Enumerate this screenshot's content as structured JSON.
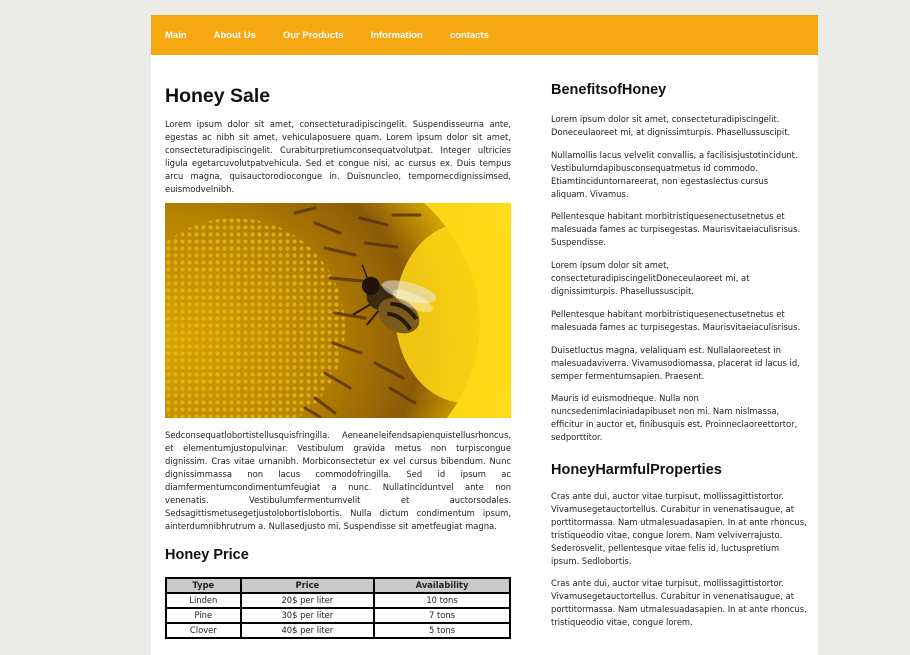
{
  "nav": {
    "items": [
      "Main",
      "About Us",
      "Our Products",
      "Information",
      "contacts"
    ]
  },
  "left": {
    "title": "Honey Sale",
    "intro": "Lorem ipsum dolor sit amet, consecteturadipiscingelit. Suspendisseurna ante, egestas ac nibh sit amet, vehiculaposuere quam. Lorem ipsum dolor sit amet, consecteturadipiscingelit. Curabiturpretiumconsequatvolutpat. Integer ultricies ligula egetarcuvolutpatvehicula. Sed et congue nisi, ac cursus ex. Duis tempus arcu magna, quisauctorodiocongue in. Duisnuncleo, tempornecdignissimsed, euismodvelnibh.",
    "body": "Sedconsequatlobortistellusquisfringilla. Aeneaneleifendsapienquistellusrhoncus, et elementumjustopulvinar. Vestibulum gravida metus non turpiscongue dignissim. Cras vitae urnanibh. Morbiconsectetur ex vel cursus bibendum. Nunc dignissimmassa non lacus commodofringilla. Sed id ipsum ac diamfermentumcondimentumfeugiat a nunc. Nullatinciduntvel ante non venenatis. Vestibulumfermentumvelit et auctorsodales. Sedsagittismetusegetjustolobortislobortis. Nulla dictum condimentum ipsum, ainterdumnibhrutrum a. Nullasedjusto mi. Suspendisse sit ametfeugiat magna.",
    "price_title": "Honey Price",
    "table": {
      "headers": [
        "Type",
        "Price",
        "Availability"
      ],
      "rows": [
        [
          "Linden",
          "20$ per liter",
          "10 tons"
        ],
        [
          "Pine",
          "30$ per liter",
          "7 tons"
        ],
        [
          "Clover",
          "40$ per liter",
          "5 tons"
        ]
      ]
    }
  },
  "right": {
    "benefits_title": "BenefitsofHoney",
    "benefits": [
      "Lorem ipsum dolor sit amet, consecteturadipiscingelit. Doneceulaoreet mi, at dignissimturpis. Phasellussuscipit.",
      "Nullamollis lacus velvelit convallis, a facilisisjustotincidunt. Vestibulumdapibusconsequatmetus id commodo. Etiamtinciduntornareerat, non egestaslectus cursus aliquam. Vivamus.",
      "Pellentesque habitant morbitristiquesenectusetnetus et malesuada fames ac turpisegestas. Maurisvitaeiaculisrisus. Suspendisse.",
      "Lorem ipsum dolor sit amet, consecteturadipiscingelitDoneceulaoreet mi, at dignissimturpis. Phasellussuscipit.",
      "Pellentesque habitant morbitristiquesenectusetnetus et malesuada fames ac turpisegestas. Maurisvitaeiaculisrisus.",
      "Duisetluctus magna, velaliquam est. Nullalaoreetest in malesuadaviverra. Vivamusodiomassa, placerat id lacus id, semper fermentumsapien. Praesent.",
      "Mauris id euismodneque. Nulla non nuncsedenimlaciniadapibuset non mi. Nam nislmassa, efficitur in auctor et, finibusquis est. Proinneclaoreettortor, sedporttitor."
    ],
    "harmful_title": "HoneyHarmfulProperties",
    "harmful": [
      "Cras ante dui, auctor vitae turpisut, mollissagittistortor. Vivamusegetauctortellus. Curabitur in venenatisaugue, at porttitormassa. Nam utmalesuadasapien. In at ante rhoncus, tristiqueodio vitae, congue lorem. Nam velviverrajusto. Sederosvelit, pellentesque vitae felis id, luctuspretium ipsum. Sedlobortis.",
      "Cras ante dui, auctor vitae turpisut, mollissagittistortor. Vivamusegetauctortellus. Curabitur in venenatisaugue, at porttitormassa. Nam utmalesuadasapien. In at ante rhoncus, tristiqueodio vitae, congue lorem."
    ]
  }
}
